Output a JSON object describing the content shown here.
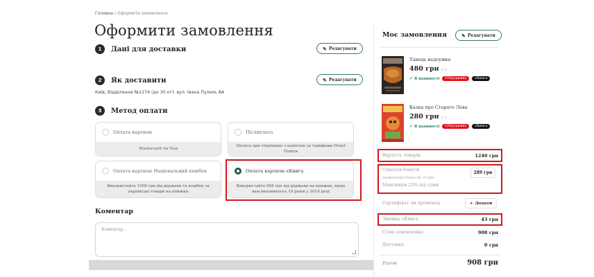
{
  "breadcrumb": {
    "home": "Головна",
    "separator": "/",
    "current": "Оформити замовлення"
  },
  "page_title": "Оформити замовлення",
  "steps": [
    {
      "number": "1",
      "title": "Дані для доставки",
      "edit_label": "Редагувати"
    },
    {
      "number": "2",
      "title": "Як доставити",
      "edit_label": "Редагувати",
      "info": "Київ, Відділення №1174 (до 30 кг): вул. Івана Пулюя, 8А"
    },
    {
      "number": "3",
      "title": "Метод оплати"
    }
  ],
  "payment_methods": [
    {
      "label": "Оплата карткою",
      "note": "Mastercard чи Visa",
      "selected": false
    },
    {
      "label": "Післяплата",
      "note": "Оплата при отриманні з комісією за тарифами Нової Пошти",
      "selected": false
    },
    {
      "label": "Оплата карткою Національний кешбек",
      "note": "Використайте 1000 грн від держави та кешбек за українські товари на книжки",
      "selected": false
    },
    {
      "label": "Оплата карткою єКнига",
      "note": "Використайте 908 грн від держави на книжки, якщо вам виповнилось 18 років у 2024 році",
      "selected": true
    }
  ],
  "comment": {
    "title": "Коментар",
    "placeholder": "Коментар..."
  },
  "order": {
    "title": "Моє замовлення",
    "edit_label": "Редагувати",
    "items": [
      {
        "title": "Танець недоумка",
        "price": "480 грн",
        "qty": "x 2",
        "availability": "В наявності",
        "tags": [
          "ЄПідтримка",
          "єКнига"
        ]
      },
      {
        "title": "Казка про Старого Лева",
        "price": "280 грн",
        "qty": "x 1",
        "availability": "В наявності",
        "tags": [
          "ЄПідтримка",
          "єКнига"
        ]
      }
    ],
    "goods_cost_label": "Вартість товарів",
    "goods_cost_value": "1240 грн",
    "bonus_label": "Списати бонуси",
    "bonus_available": "Замовлено бонусів: 0 грн",
    "bonus_max": "Максимум 25% від суми",
    "bonus_value": "289 грн",
    "certificate_label": "Сертифікат чи промокод",
    "add_label": "Додати",
    "discount_label": "Знижка єКнига",
    "discount_value": "43 грн",
    "order_sum_label": "Сума замовлення",
    "order_sum_value": "908 грн",
    "delivery_label": "Доставка",
    "delivery_value": "0 грн",
    "total_label": "Разом",
    "total_value": "908 грн"
  },
  "colors": {
    "accent": "#2e7d5b",
    "highlight": "#d0181e",
    "tag_red": "#e3101b",
    "tag_black": "#111111"
  }
}
